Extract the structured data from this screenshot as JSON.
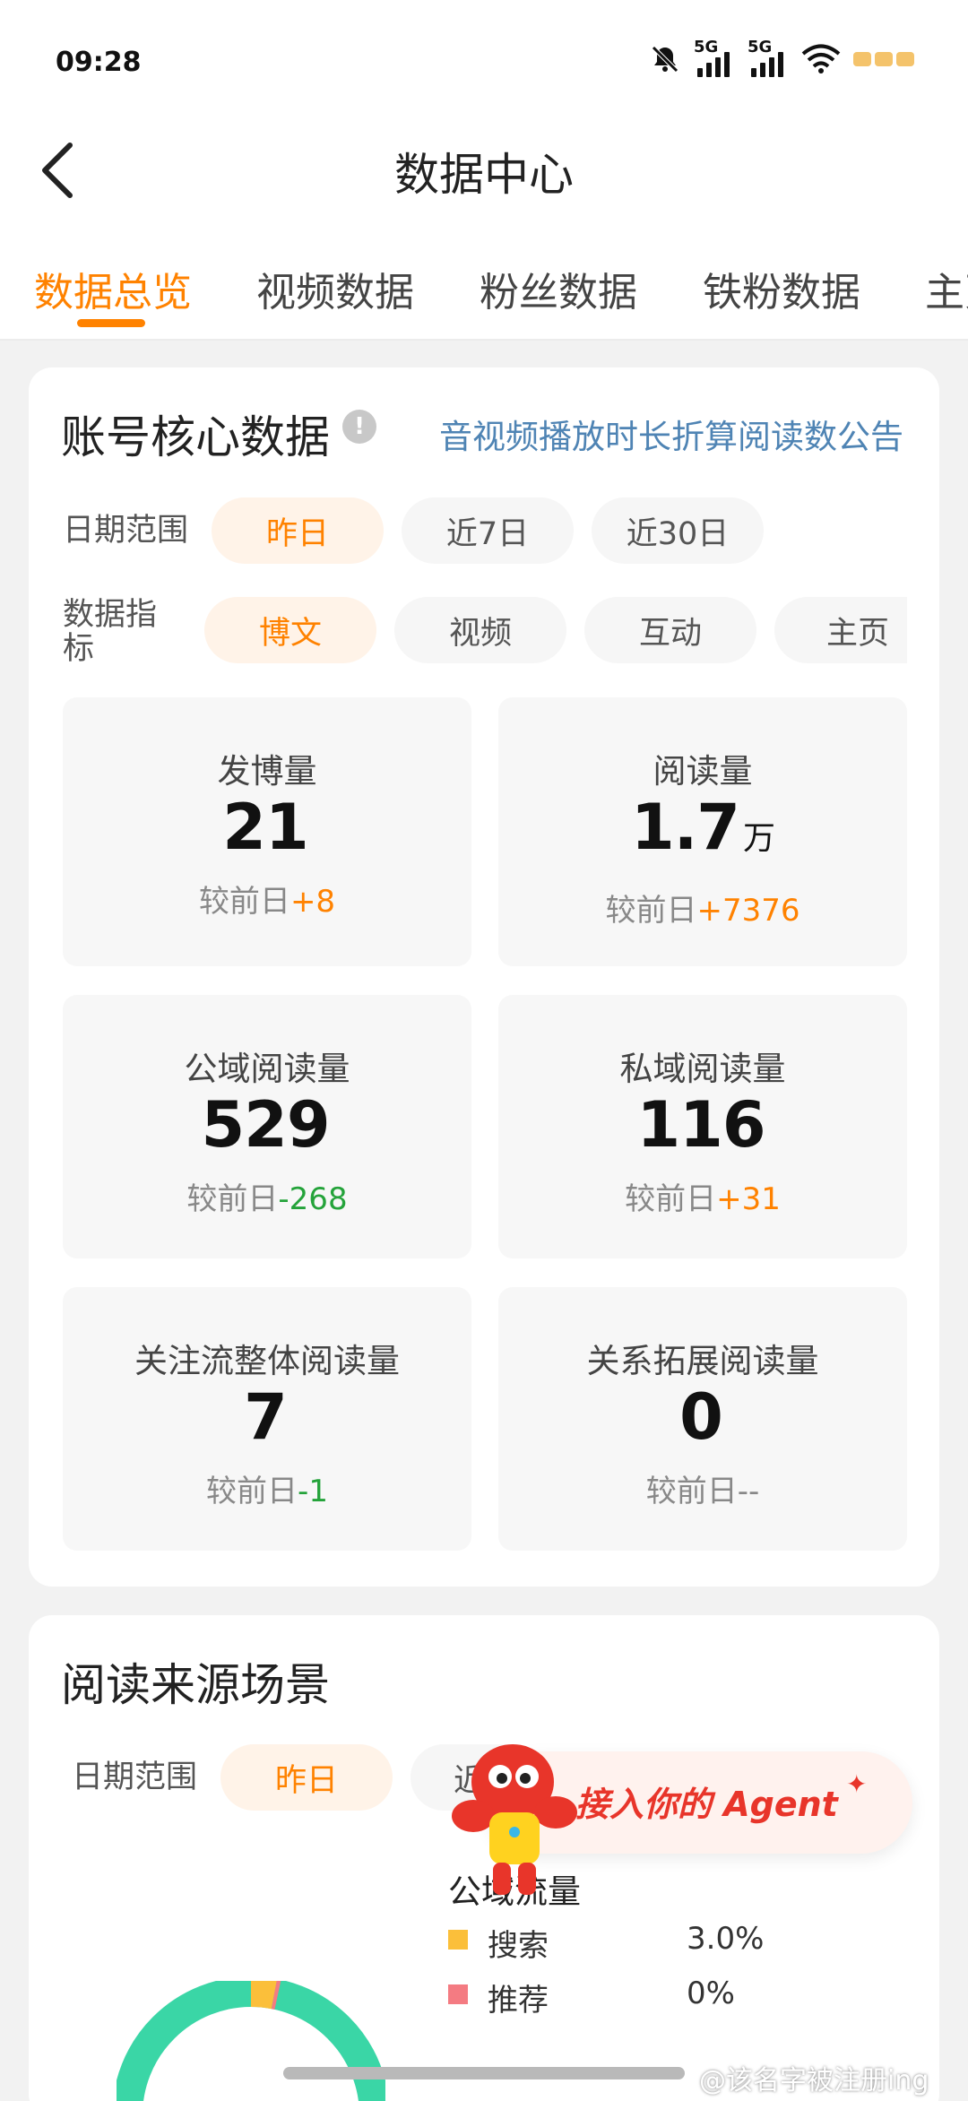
{
  "status_bar": {
    "time": "09:28",
    "signal_label_1": "5G",
    "signal_label_2": "5G",
    "icons": [
      "bell-off-icon",
      "signal-icon",
      "signal-icon",
      "wifi-icon",
      "battery-icon"
    ]
  },
  "header": {
    "title": "数据中心",
    "back_icon": "chevron-left-icon"
  },
  "tabs": [
    {
      "label": "数据总览",
      "active": true
    },
    {
      "label": "视频数据",
      "active": false
    },
    {
      "label": "粉丝数据",
      "active": false
    },
    {
      "label": "铁粉数据",
      "active": false
    },
    {
      "label": "主页",
      "active": false
    }
  ],
  "core": {
    "title": "账号核心数据",
    "info_icon": "exclamation-circle-icon",
    "notice_link": "音视频播放时长折算阅读数公告",
    "date_label": "日期范围",
    "date_options": [
      {
        "label": "昨日",
        "active": true
      },
      {
        "label": "近7日",
        "active": false
      },
      {
        "label": "近30日",
        "active": false
      }
    ],
    "metric_label_line1": "数据指",
    "metric_label_line2": "标",
    "metric_options": [
      {
        "label": "博文",
        "active": true
      },
      {
        "label": "视频",
        "active": false
      },
      {
        "label": "互动",
        "active": false
      },
      {
        "label": "主页",
        "active": false
      }
    ],
    "compare_prefix": "较前日",
    "metrics": [
      {
        "label": "发博量",
        "value": "21",
        "unit": "",
        "delta": "+8",
        "trend": "up"
      },
      {
        "label": "阅读量",
        "value": "1.7",
        "unit": "万",
        "delta": "+7376",
        "trend": "up"
      },
      {
        "label": "公域阅读量",
        "value": "529",
        "unit": "",
        "delta": "-268",
        "trend": "down"
      },
      {
        "label": "私域阅读量",
        "value": "116",
        "unit": "",
        "delta": "+31",
        "trend": "up"
      },
      {
        "label": "关注流整体阅读量",
        "value": "7",
        "unit": "",
        "delta": "-1",
        "trend": "down"
      },
      {
        "label": "关系拓展阅读量",
        "value": "0",
        "unit": "",
        "delta": "--",
        "trend": "none"
      }
    ]
  },
  "source": {
    "title": "阅读来源场景",
    "date_label": "日期范围",
    "date_active": "昨日",
    "date_partial": "近",
    "legend_title": "公域流量",
    "legend": [
      {
        "name": "搜索",
        "value": "3.0%",
        "color": "#fbbf3a"
      },
      {
        "name": "推荐",
        "value": "0%",
        "color": "#f47b82"
      }
    ],
    "donut_colors": {
      "main": "#3ad6a6",
      "search": "#fbbf3a",
      "recommend": "#f47b82"
    }
  },
  "agent_banner": {
    "text": "接入你的 Agent",
    "mascot_icon": "lobster-mascot-icon"
  },
  "watermark": "@该名字被注册ing"
}
